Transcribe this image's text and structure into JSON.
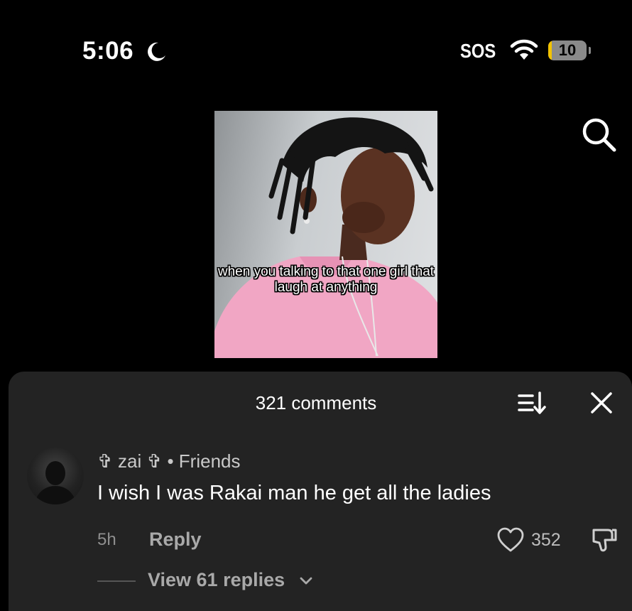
{
  "status_bar": {
    "time": "5:06",
    "carrier": "SOS",
    "battery": "10",
    "battery_level_percent": 10,
    "battery_fill_color": "#f3c300",
    "icons": [
      "moon-icon",
      "wifi-icon",
      "battery-icon"
    ]
  },
  "header": {
    "icons": [
      "search-icon"
    ]
  },
  "video": {
    "caption": "when you talking to that one girl that laugh at anything"
  },
  "comments_sheet": {
    "count_label": "321 comments",
    "icons": [
      "sort-icon",
      "close-icon"
    ],
    "comment": {
      "username": "✞ zai ✞ • Friends",
      "text": "I wish I was Rakai man he get all the ladies",
      "age": "5h",
      "reply_label": "Reply",
      "likes": "352",
      "view_replies_label": "View 61 replies",
      "icons": [
        "heart-icon",
        "dislike-icon",
        "chevron-down-icon"
      ]
    }
  },
  "colors": {
    "background": "#000000",
    "sheet": "#232323",
    "muted_text": "#a9a9a9"
  }
}
